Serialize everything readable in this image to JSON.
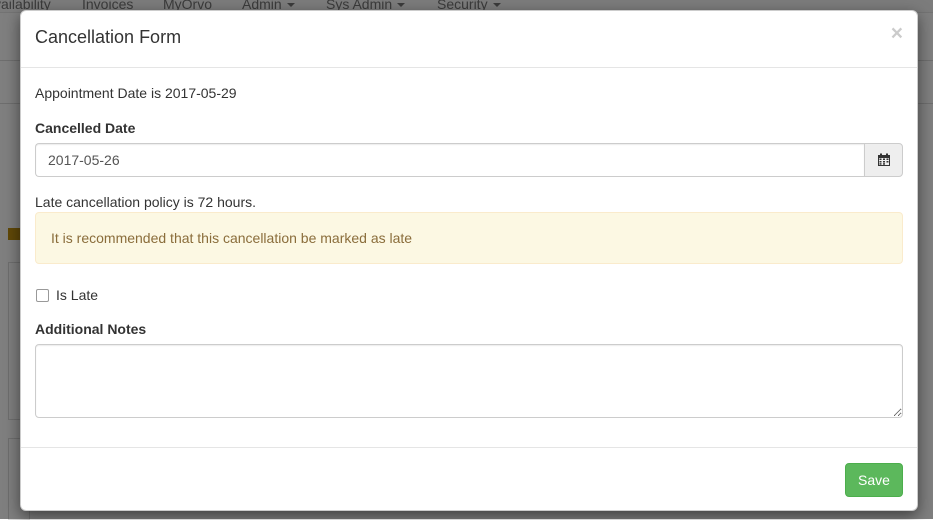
{
  "background_nav": {
    "items": [
      {
        "label": "vailability",
        "dropdown": false
      },
      {
        "label": "Invoices",
        "dropdown": false
      },
      {
        "label": "MyOrvo",
        "dropdown": false
      },
      {
        "label": "Admin",
        "dropdown": true
      },
      {
        "label": "Sys Admin",
        "dropdown": true
      },
      {
        "label": "Security",
        "dropdown": true
      }
    ]
  },
  "modal": {
    "title": "Cancellation Form",
    "close_glyph": "×",
    "appointment_text": "Appointment Date is 2017-05-29",
    "cancelled_date_label": "Cancelled Date",
    "cancelled_date_value": "2017-05-26",
    "calendar_icon": "calendar-icon",
    "policy_text": "Late cancellation policy is 72 hours.",
    "alert_text": "It is recommended that this cancellation be marked as late",
    "is_late_label": "Is Late",
    "is_late_checked": false,
    "notes_label": "Additional Notes",
    "notes_value": "",
    "save_label": "Save"
  },
  "colors": {
    "alert_bg": "#fcf8e3",
    "alert_text": "#8a6d3b",
    "save_button": "#5cb85c"
  }
}
